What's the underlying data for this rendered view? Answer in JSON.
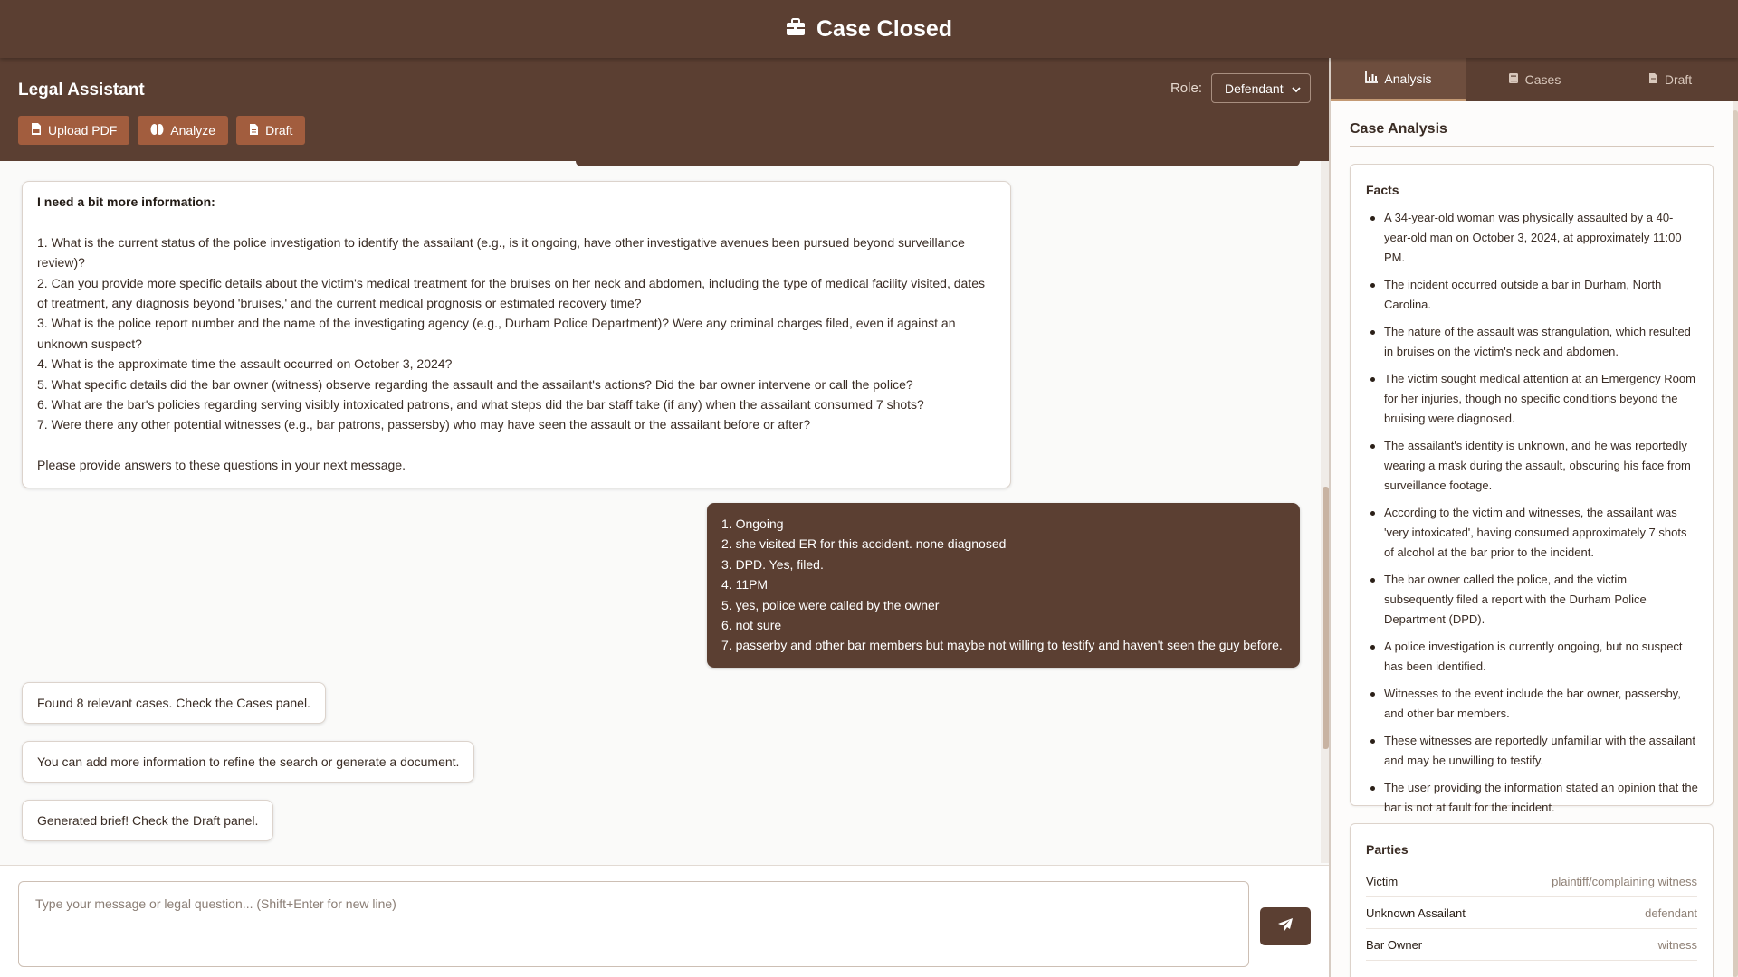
{
  "app": {
    "title": "Case Closed"
  },
  "left_header": {
    "title": "Legal Assistant",
    "role_label": "Role:",
    "role_value": "Defendant",
    "buttons": {
      "upload": "Upload PDF",
      "analyze": "Analyze",
      "draft": "Draft"
    }
  },
  "chat": {
    "info_request": {
      "heading": "I need a bit more information:",
      "questions": [
        "1. What is the current status of the police investigation to identify the assailant (e.g., is it ongoing, have other investigative avenues been pursued beyond surveillance review)?",
        "2. Can you provide more specific details about the victim's medical treatment for the bruises on her neck and abdomen, including the type of medical facility visited, dates of treatment, any diagnosis beyond 'bruises,' and the current medical prognosis or estimated recovery time?",
        "3. What is the police report number and the name of the investigating agency (e.g., Durham Police Department)? Were any criminal charges filed, even if against an unknown suspect?",
        "4. What is the approximate time the assault occurred on October 3, 2024?",
        "5. What specific details did the bar owner (witness) observe regarding the assault and the assailant's actions? Did the bar owner intervene or call the police?",
        "6. What are the bar's policies regarding serving visibly intoxicated patrons, and what steps did the bar staff take (if any) when the assailant consumed 7 shots?",
        "7. Were there any other potential witnesses (e.g., bar patrons, passersby) who may have seen the assault or the assailant before or after?"
      ],
      "closing": "Please provide answers to these questions in your next message."
    },
    "user_reply": [
      "1. Ongoing",
      "2. she visited ER for this accident. none diagnosed",
      "3. DPD. Yes, filed.",
      "4. 11PM",
      "5. yes, police were called by the owner",
      "6. not sure",
      "7. passerby and other bar members but maybe not willing to testify and haven't seen the guy before."
    ],
    "status_messages": [
      "Found 8 relevant cases. Check the Cases panel.",
      "You can add more information to refine the search or generate a document.",
      "Generated brief! Check the Draft panel."
    ]
  },
  "input": {
    "placeholder": "Type your message or legal question... (Shift+Enter for new line)"
  },
  "tabs": {
    "analysis": "Analysis",
    "cases": "Cases",
    "draft": "Draft"
  },
  "analysis": {
    "title": "Case Analysis",
    "facts_title": "Facts",
    "facts": [
      "A 34-year-old woman was physically assaulted by a 40-year-old man on October 3, 2024, at approximately 11:00 PM.",
      "The incident occurred outside a bar in Durham, North Carolina.",
      "The nature of the assault was strangulation, which resulted in bruises on the victim's neck and abdomen.",
      "The victim sought medical attention at an Emergency Room for her injuries, though no specific conditions beyond the bruising were diagnosed.",
      "The assailant's identity is unknown, and he was reportedly wearing a mask during the assault, obscuring his face from surveillance footage.",
      "According to the victim and witnesses, the assailant was 'very intoxicated', having consumed approximately 7 shots of alcohol at the bar prior to the incident.",
      "The bar owner called the police, and the victim subsequently filed a report with the Durham Police Department (DPD).",
      "A police investigation is currently ongoing, but no suspect has been identified.",
      "Witnesses to the event include the bar owner, passersby, and other bar members.",
      "These witnesses are reportedly unfamiliar with the assailant and may be unwilling to testify.",
      "The user providing the information stated an opinion that the bar is not at fault for the incident."
    ],
    "parties_title": "Parties",
    "parties": [
      {
        "name": "Victim",
        "role": "plaintiff/complaining witness"
      },
      {
        "name": "Unknown Assailant",
        "role": "defendant"
      },
      {
        "name": "Bar Owner",
        "role": "witness"
      }
    ]
  },
  "colors": {
    "brown": "#5b3f32",
    "accent_button": "#a25d3e",
    "tab_underline": "#c49a74"
  },
  "icons": [
    "briefcase-icon",
    "file-pdf-icon",
    "brain-icon",
    "file-icon",
    "chevron-down-icon",
    "paper-plane-icon",
    "chart-icon",
    "book-icon"
  ]
}
